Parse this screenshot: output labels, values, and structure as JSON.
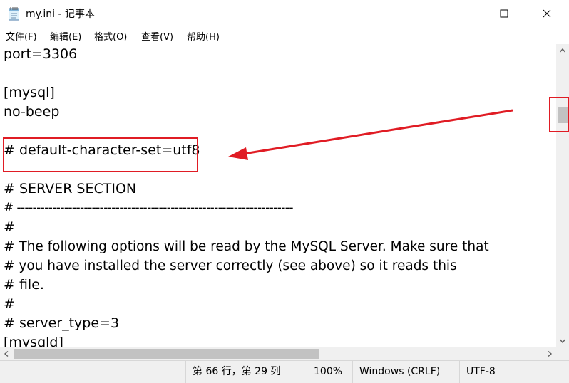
{
  "window": {
    "title": "my.ini - 记事本",
    "controls": {
      "minimize": "minimize",
      "maximize": "maximize",
      "close": "close"
    }
  },
  "menu": [
    {
      "label": "文件(F)"
    },
    {
      "label": "编辑(E)"
    },
    {
      "label": "格式(O)"
    },
    {
      "label": "查看(V)"
    },
    {
      "label": "帮助(H)"
    }
  ],
  "editor": {
    "lines": [
      "port=3306",
      "",
      "[mysql]",
      "no-beep",
      "",
      "# default-character-set=utf8",
      "",
      "# SERVER SECTION",
      "# ----------------------------------------------------------------------",
      "#",
      "# The following options will be read by the MySQL Server. Make sure that",
      "# you have installed the server correctly (see above) so it reads this",
      "# file.",
      "#",
      "# server_type=3",
      "[mysqld]"
    ]
  },
  "status": {
    "position": "第 66 行，第 29 列",
    "zoom": "100%",
    "line_ending": "Windows (CRLF)",
    "encoding": "UTF-8"
  },
  "annotations": {
    "color": "#e01c24",
    "highlighted_line": "# default-character-set=utf8"
  },
  "icons": {
    "app": "notepad-icon",
    "minimize": "minimize-icon",
    "maximize": "maximize-icon",
    "close": "close-icon",
    "scroll_up": "arrow-up-icon",
    "scroll_down": "arrow-down-icon",
    "scroll_left": "arrow-left-icon",
    "scroll_right": "arrow-right-icon"
  }
}
